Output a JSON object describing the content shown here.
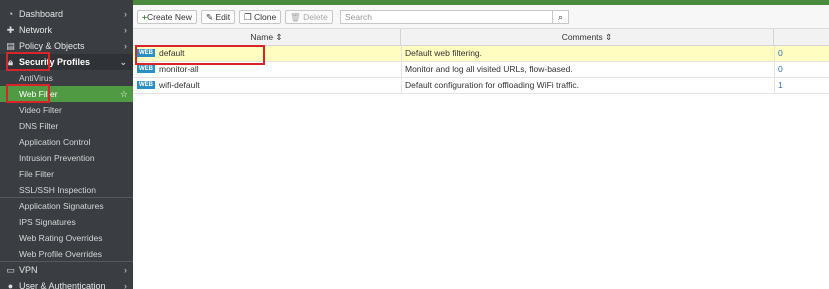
{
  "sidebar": {
    "top_items": [
      {
        "label": "Dashboard",
        "icon": "dashboard-icon"
      },
      {
        "label": "Network",
        "icon": "network-icon"
      },
      {
        "label": "Policy & Objects",
        "icon": "policy-icon"
      },
      {
        "label": "Security Profiles",
        "icon": "lock-icon"
      }
    ],
    "sub_items": [
      "AntiVirus",
      "Web Filter",
      "Video Filter",
      "DNS Filter",
      "Application Control",
      "Intrusion Prevention",
      "File Filter",
      "SSL/SSH Inspection",
      "Application Signatures",
      "IPS Signatures",
      "Web Rating Overrides",
      "Web Profile Overrides"
    ],
    "bottom_items": [
      {
        "label": "VPN",
        "icon": "vpn-icon"
      },
      {
        "label": "User & Authentication",
        "icon": "user-icon"
      }
    ]
  },
  "toolbar": {
    "create_label": "Create New",
    "edit_label": "Edit",
    "clone_label": "Clone",
    "delete_label": "Delete",
    "search_placeholder": "Search"
  },
  "table": {
    "columns": [
      "Name",
      "Comments"
    ],
    "rows": [
      {
        "badge": "WEB",
        "name": "default",
        "comment": "Default web filtering.",
        "refs": "0"
      },
      {
        "badge": "WEB",
        "name": "monitor-all",
        "comment": "Monitor and log all visited URLs, flow-based.",
        "refs": "0"
      },
      {
        "badge": "WEB",
        "name": "wifi-default",
        "comment": "Default configuration for offloading WiFi traffic.",
        "refs": "1"
      }
    ]
  },
  "colors": {
    "sidebar_bg": "#3a3d42",
    "active_green": "#4f9a43",
    "highlight_red": "#d9252a",
    "selected_row": "#fffdc0",
    "badge_blue": "#2a8fc4"
  }
}
